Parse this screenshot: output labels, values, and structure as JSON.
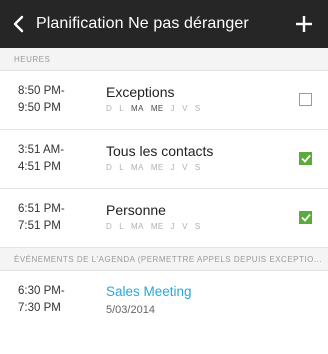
{
  "appbar": {
    "back_icon": "chevron-left-icon",
    "title": "Planification Ne pas déranger",
    "add_icon": "plus-icon"
  },
  "section_hours": {
    "title": "HEURES"
  },
  "schedules": [
    {
      "start": "8:50 PM-",
      "end": "9:50 PM",
      "label": "Exceptions",
      "days": [
        "D",
        "L",
        "MA",
        "ME",
        "J",
        "V",
        "S"
      ],
      "days_active": [
        false,
        false,
        true,
        true,
        false,
        false,
        false
      ],
      "checked": false
    },
    {
      "start": "3:51 AM-",
      "end": "4:51 PM",
      "label": "Tous les contacts",
      "days": [
        "D",
        "L",
        "MA",
        "ME",
        "J",
        "V",
        "S"
      ],
      "days_active": [
        false,
        false,
        false,
        false,
        false,
        false,
        false
      ],
      "checked": true
    },
    {
      "start": "6:51 PM-",
      "end": "7:51 PM",
      "label": "Personne",
      "days": [
        "D",
        "L",
        "MA",
        "ME",
        "J",
        "V",
        "S"
      ],
      "days_active": [
        false,
        false,
        false,
        false,
        false,
        false,
        false
      ],
      "checked": true
    }
  ],
  "section_events": {
    "title": "ÉVÉNEMENTS DE L'AGENDA (PERMETTRE APPELS DEPUIS EXCEPTIO..."
  },
  "event": {
    "start": "6:30 PM-",
    "end": "7:30 PM",
    "title": "Sales Meeting",
    "date": "5/03/2014"
  },
  "colors": {
    "appbar": "#262626",
    "check": "#5aab3a",
    "link": "#2aa7d9"
  }
}
